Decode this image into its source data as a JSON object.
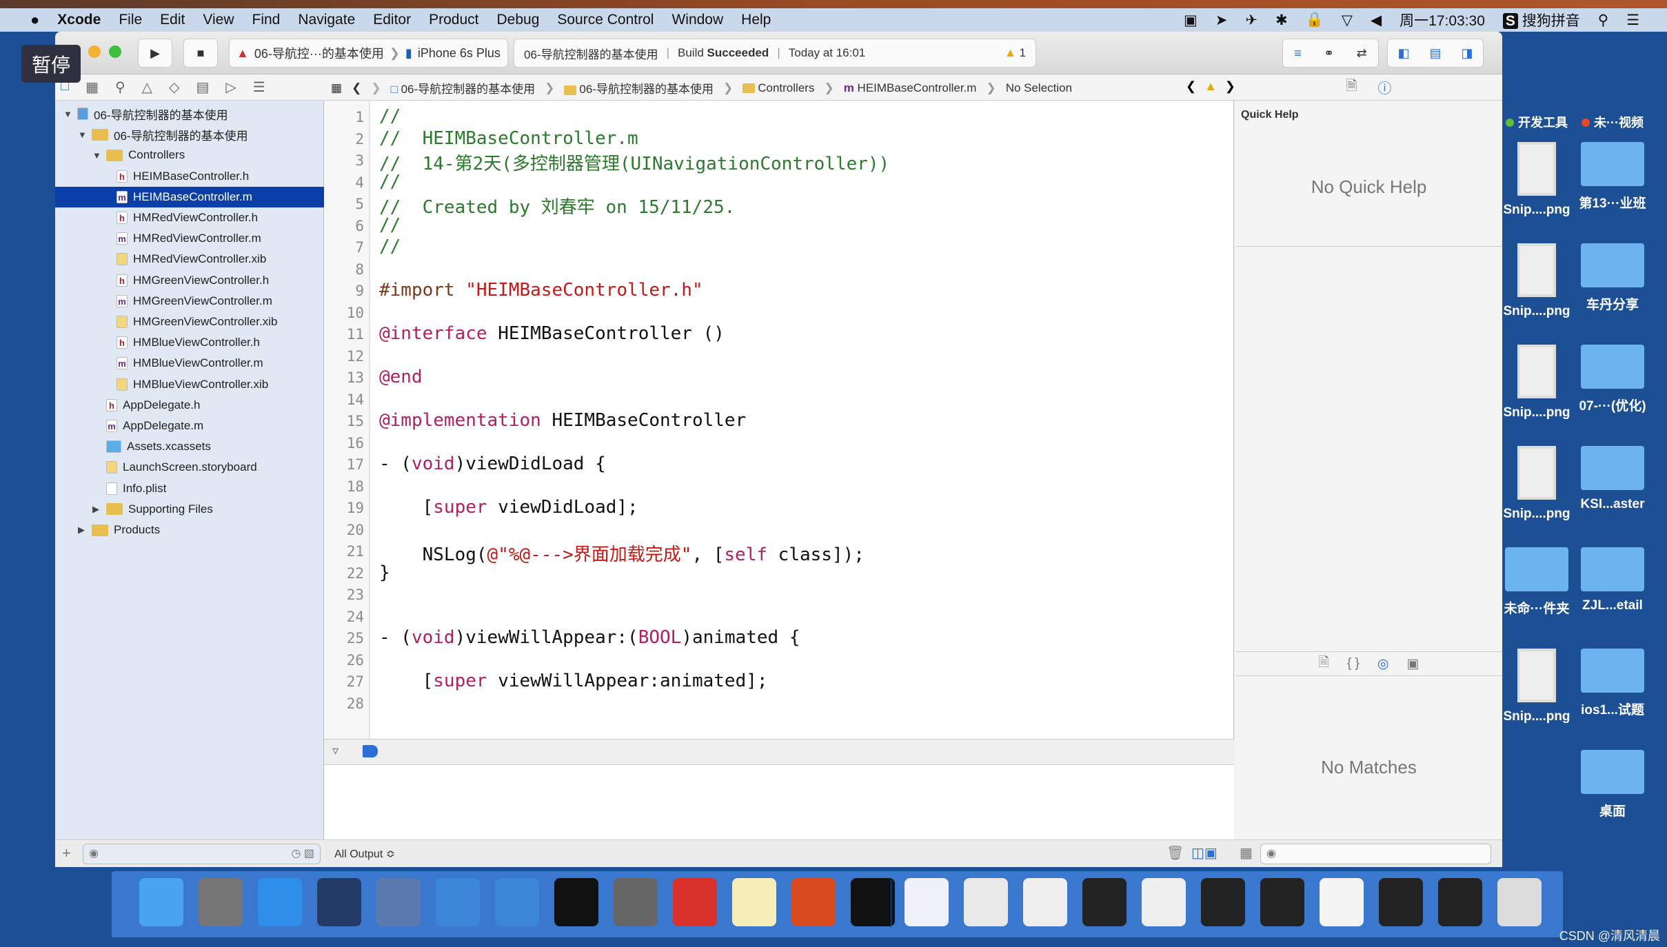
{
  "menubar": {
    "items": [
      "Xcode",
      "File",
      "Edit",
      "View",
      "Find",
      "Navigate",
      "Editor",
      "Product",
      "Debug",
      "Source Control",
      "Window",
      "Help"
    ],
    "clock": "周一17:03:30",
    "input_method": "搜狗拼音"
  },
  "toolbar": {
    "scheme": "06-导航控···的基本使用",
    "device": "iPhone 6s Plus",
    "activity_project": "06-导航控制器的基本使用",
    "build_label": "Build",
    "build_status": "Succeeded",
    "time": "Today at 16:01",
    "warnings": "1"
  },
  "jumpbar": [
    "06-导航控制器的基本使用",
    "06-导航控制器的基本使用",
    "Controllers",
    "HEIMBaseController.m",
    "No Selection"
  ],
  "navigator": {
    "items": [
      {
        "label": "06-导航控制器的基本使用",
        "type": "project",
        "level": 0,
        "open": true
      },
      {
        "label": "06-导航控制器的基本使用",
        "type": "folder",
        "level": 1,
        "open": true
      },
      {
        "label": "Controllers",
        "type": "folder",
        "level": 2,
        "open": true
      },
      {
        "label": "HEIMBaseController.h",
        "type": "h",
        "level": 3
      },
      {
        "label": "HEIMBaseController.m",
        "type": "m",
        "level": 3,
        "selected": true
      },
      {
        "label": "HMRedViewController.h",
        "type": "h",
        "level": 3
      },
      {
        "label": "HMRedViewController.m",
        "type": "m",
        "level": 3
      },
      {
        "label": "HMRedViewController.xib",
        "type": "xib",
        "level": 3
      },
      {
        "label": "HMGreenViewController.h",
        "type": "h",
        "level": 3
      },
      {
        "label": "HMGreenViewController.m",
        "type": "m",
        "level": 3
      },
      {
        "label": "HMGreenViewController.xib",
        "type": "xib",
        "level": 3
      },
      {
        "label": "HMBlueViewController.h",
        "type": "h",
        "level": 3
      },
      {
        "label": "HMBlueViewController.m",
        "type": "m",
        "level": 3
      },
      {
        "label": "HMBlueViewController.xib",
        "type": "xib",
        "level": 3
      },
      {
        "label": "AppDelegate.h",
        "type": "h",
        "level": 2
      },
      {
        "label": "AppDelegate.m",
        "type": "m",
        "level": 2
      },
      {
        "label": "Assets.xcassets",
        "type": "assets",
        "level": 2
      },
      {
        "label": "LaunchScreen.storyboard",
        "type": "xib",
        "level": 2
      },
      {
        "label": "Info.plist",
        "type": "plist",
        "level": 2
      },
      {
        "label": "Supporting Files",
        "type": "folder",
        "level": 2,
        "open": false
      },
      {
        "label": "Products",
        "type": "folder",
        "level": 1,
        "open": false
      }
    ]
  },
  "code": [
    [
      [
        "//",
        "comment"
      ]
    ],
    [
      [
        "//  HEIMBaseController.m",
        "comment"
      ]
    ],
    [
      [
        "//  14-第2天(多控制器管理(UINavigationController))",
        "comment"
      ]
    ],
    [
      [
        "//",
        "comment"
      ]
    ],
    [
      [
        "//  Created by 刘春牢 on 15/11/25.",
        "comment"
      ]
    ],
    [
      [
        "//",
        "comment"
      ]
    ],
    [
      [
        "//",
        "comment"
      ]
    ],
    [],
    [
      [
        "#import ",
        "directive"
      ],
      [
        "\"HEIMBaseController.h\"",
        "string"
      ]
    ],
    [],
    [
      [
        "@interface",
        "keyword"
      ],
      [
        " HEIMBaseController ()",
        "plain"
      ]
    ],
    [],
    [
      [
        "@end",
        "keyword"
      ]
    ],
    [],
    [
      [
        "@implementation",
        "keyword"
      ],
      [
        " HEIMBaseController",
        "plain"
      ]
    ],
    [],
    [
      [
        "- (",
        "plain"
      ],
      [
        "void",
        "keyword"
      ],
      [
        ")viewDidLoad {",
        "plain"
      ]
    ],
    [],
    [
      [
        "    [",
        "plain"
      ],
      [
        "super",
        "keyword"
      ],
      [
        " viewDidLoad];",
        "plain"
      ]
    ],
    [],
    [
      [
        "    NSLog(",
        "plain"
      ],
      [
        "@\"%@--->界面加载完成\"",
        "string"
      ],
      [
        ", [",
        "plain"
      ],
      [
        "self",
        "keyword"
      ],
      [
        " class]);",
        "plain"
      ]
    ],
    [
      [
        "}",
        "plain"
      ]
    ],
    [],
    [],
    [
      [
        "- (",
        "plain"
      ],
      [
        "void",
        "keyword"
      ],
      [
        ")viewWillAppear:(",
        "plain"
      ],
      [
        "BOOL",
        "keyword"
      ],
      [
        ")animated {",
        "plain"
      ]
    ],
    [],
    [
      [
        "    [",
        "plain"
      ],
      [
        "super",
        "keyword"
      ],
      [
        " viewWillAppear:animated];",
        "plain"
      ]
    ],
    []
  ],
  "debug": {
    "output_selector": "All Output ≎"
  },
  "inspector": {
    "quick_help_title": "Quick Help",
    "no_quick_help": "No Quick Help",
    "no_matches": "No Matches"
  },
  "desktop": [
    {
      "label": "开发工具",
      "kind": "tag",
      "color": "#5cbf3a"
    },
    {
      "label": "未···视频",
      "kind": "tag",
      "color": "#e5482e"
    },
    {
      "label": "Snip....png",
      "kind": "image"
    },
    {
      "label": "第13···业班",
      "kind": "folder"
    },
    {
      "label": "Snip....png",
      "kind": "image"
    },
    {
      "label": "车丹分享",
      "kind": "folder"
    },
    {
      "label": "Snip....png",
      "kind": "image"
    },
    {
      "label": "07-···(优化)",
      "kind": "folder"
    },
    {
      "label": "Snip....png",
      "kind": "image"
    },
    {
      "label": "KSI...aster",
      "kind": "folder"
    },
    {
      "label": "未命···件夹",
      "kind": "folder"
    },
    {
      "label": "ZJL...etail",
      "kind": "folder"
    },
    {
      "label": "Snip....png",
      "kind": "image"
    },
    {
      "label": "ios1...试题",
      "kind": "folder"
    },
    {
      "label": "",
      "kind": "none"
    },
    {
      "label": "桌面",
      "kind": "folder"
    }
  ],
  "dock": [
    {
      "name": "finder",
      "color": "#4aa3f0"
    },
    {
      "name": "launchpad",
      "color": "#777"
    },
    {
      "name": "safari",
      "color": "#2e8ee8"
    },
    {
      "name": "mouse-app",
      "color": "#243a66"
    },
    {
      "name": "photo-booth",
      "color": "#5a7ab0"
    },
    {
      "name": "xcode",
      "color": "#3b86d6"
    },
    {
      "name": "instruments",
      "color": "#3b86d6"
    },
    {
      "name": "terminal",
      "color": "#111"
    },
    {
      "name": "system-preferences",
      "color": "#666"
    },
    {
      "name": "xmind",
      "color": "#d8322a"
    },
    {
      "name": "notes",
      "color": "#f6eeb8"
    },
    {
      "name": "powerpoint",
      "color": "#d9491e"
    },
    {
      "name": "console",
      "color": "#111"
    },
    {
      "name": "doc-1",
      "color": "#eef2f8"
    },
    {
      "name": "doc-2",
      "color": "#e8e8e8"
    },
    {
      "name": "doc-3",
      "color": "#eeeeee"
    },
    {
      "name": "screen-1",
      "color": "#222"
    },
    {
      "name": "doc-4",
      "color": "#eee"
    },
    {
      "name": "screen-2",
      "color": "#222"
    },
    {
      "name": "screen-3",
      "color": "#222"
    },
    {
      "name": "doc-5",
      "color": "#f4f4f4"
    },
    {
      "name": "screen-4",
      "color": "#222"
    },
    {
      "name": "screen-5",
      "color": "#222"
    },
    {
      "name": "trash",
      "color": "#dcdcdc"
    }
  ],
  "overlay": {
    "pause": "暂停"
  },
  "watermark": "CSDN @清风清晨",
  "colors": {
    "selection": "#0b3ea6",
    "comment": "#2c7a2c",
    "keyword": "#b0205e",
    "string": "#c41a16",
    "desktop": "#1d4f95"
  }
}
